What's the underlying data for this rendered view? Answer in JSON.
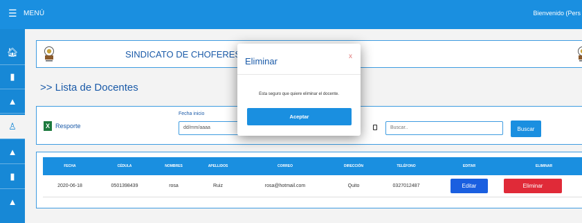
{
  "topbar": {
    "menu_icon": "hamburger-icon",
    "menu_label": "MENÚ",
    "welcome": "Bienvenido (Pers"
  },
  "sidebar": {
    "items": [
      {
        "icon": "home-icon",
        "glyph": "🏠︎"
      },
      {
        "icon": "document-icon",
        "glyph": "▮"
      },
      {
        "icon": "user-icon",
        "glyph": "▲"
      },
      {
        "icon": "teacher-icon",
        "glyph": "♙"
      },
      {
        "icon": "user-icon",
        "glyph": "▲"
      },
      {
        "icon": "file-icon",
        "glyph": "▮"
      },
      {
        "icon": "user-group-icon",
        "glyph": "▲"
      }
    ]
  },
  "header": {
    "title": "SINDICATO DE CHOFERES PROFESI"
  },
  "page": {
    "list_title": ">> Lista de Docentes"
  },
  "filters": {
    "report_label": "Resporte",
    "excel_icon_glyph": "X",
    "date_label": "Fecha inicio",
    "date_placeholder": "dd/mm/aaaa",
    "search_placeholder": "Buscar..",
    "search_button": "Buscar"
  },
  "table": {
    "headers": [
      "FECHA",
      "CÉDULA",
      "NOMBRES",
      "APELLIDOS",
      "CORREO",
      "DIRECCIÓN",
      "TELÉFONO",
      "EDITAR",
      "ELIMINAR"
    ],
    "rows": [
      {
        "fecha": "2020-06-18",
        "cedula": "0501398439",
        "nombres": "rosa",
        "apellidos": "Ruiz",
        "correo": "rosa@hotmail.com",
        "direccion": "Quito",
        "telefono": "0327012487",
        "edit_label": "Editar",
        "delete_label": "Eliminar"
      }
    ]
  },
  "modal": {
    "title": "Eliminar",
    "close": "x",
    "message": "Esta seguro que quiere eliminar el docente.",
    "accept": "Aceptar"
  },
  "colors": {
    "primary": "#1a8fe0",
    "edit": "#1a5fe0",
    "delete": "#e02a38",
    "title_text": "#1a5aa8"
  }
}
